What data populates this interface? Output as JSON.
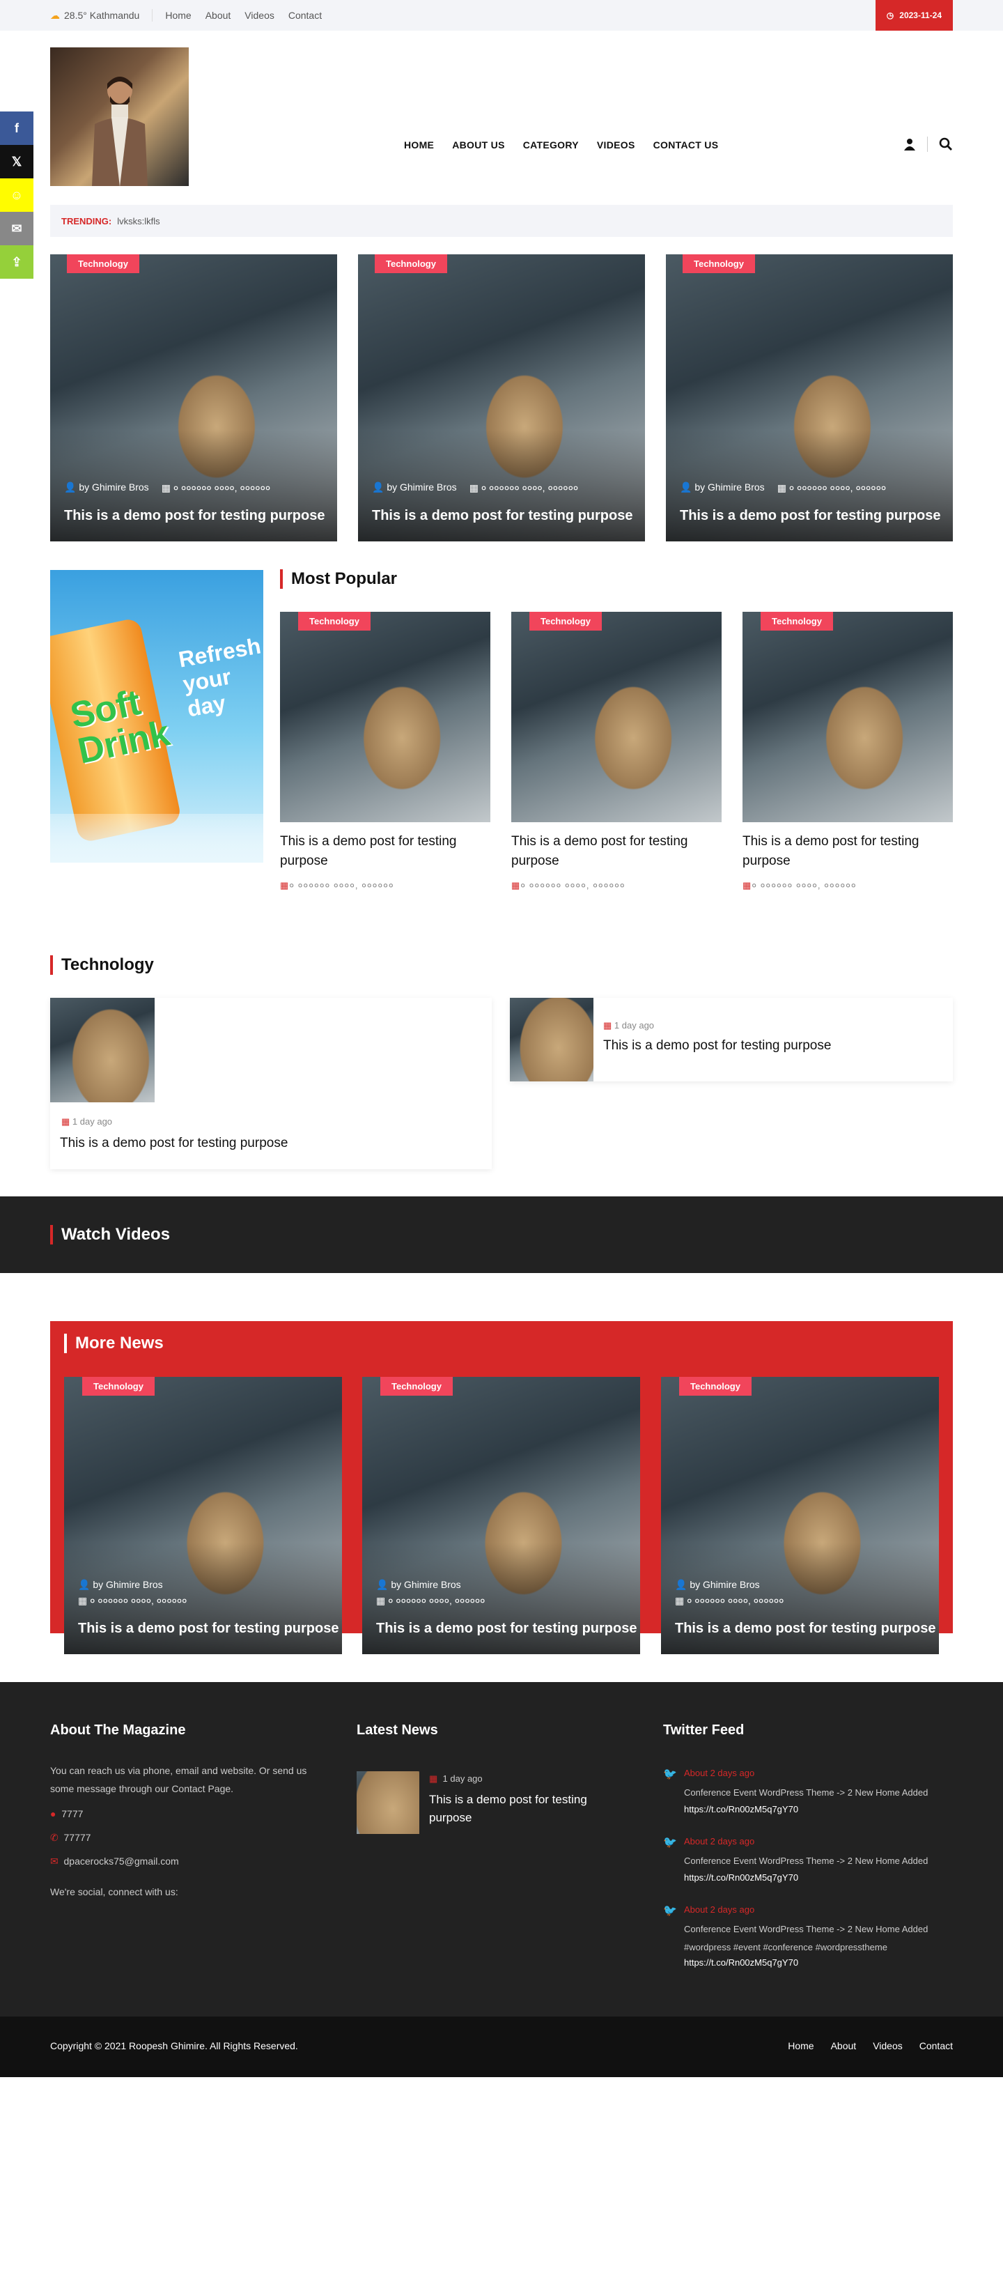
{
  "topbar": {
    "weather": "28.5° Kathmandu",
    "links": [
      "Home",
      "About",
      "Videos",
      "Contact"
    ],
    "date": "2023-11-24"
  },
  "nav": [
    "HOME",
    "ABOUT US",
    "CATEGORY",
    "VIDEOS",
    "CONTACT US"
  ],
  "trending": {
    "label": "TRENDING:",
    "value": "lvksks:lkfls"
  },
  "common": {
    "category": "Technology",
    "author": "by Ghimire Bros",
    "date_nepali": "० ०००००० ००००, ००००००",
    "title": "This is a demo post for testing purpose",
    "ago": "1 day ago"
  },
  "sections": {
    "most_popular": "Most Popular",
    "technology": "Technology",
    "watch_videos": "Watch Videos",
    "more_news": "More News"
  },
  "ad": {
    "line1": "Soft",
    "line2": "Drink",
    "line3": "Refresh",
    "line4": "your day"
  },
  "footer": {
    "about_title": "About The Magazine",
    "about_text": "You can reach us via phone, email and website. Or send us some message through our Contact Page.",
    "location": "7777",
    "phone": "77777",
    "email": "dpacerocks75@gmail.com",
    "social": "We're social, connect with us:",
    "latest_title": "Latest News",
    "latest_ago": "1 day ago",
    "latest_post": "This is a demo post for testing purpose",
    "twitter_title": "Twitter Feed",
    "tweets": [
      {
        "time": "About 2 days ago",
        "text": "Conference Event WordPress Theme -> 2 New Home Added",
        "link": "https://t.co/Rn00zM5q7gY70"
      },
      {
        "time": "About 2 days ago",
        "text": "Conference Event WordPress Theme -> 2 New Home Added",
        "link": "https://t.co/Rn00zM5q7gY70"
      },
      {
        "time": "About 2 days ago",
        "text": "Conference Event WordPress Theme -> 2 New Home Added #wordpress #event #conference #wordpresstheme",
        "link": "https://t.co/Rn00zM5q7gY70"
      }
    ]
  },
  "copyright": "Copyright © 2021 Roopesh Ghimire. All Rights Reserved.",
  "bottom_links": [
    "Home",
    "About",
    "Videos",
    "Contact"
  ],
  "colors": {
    "accent": "#d62828",
    "badge": "#f1455b",
    "dark": "#222222"
  }
}
